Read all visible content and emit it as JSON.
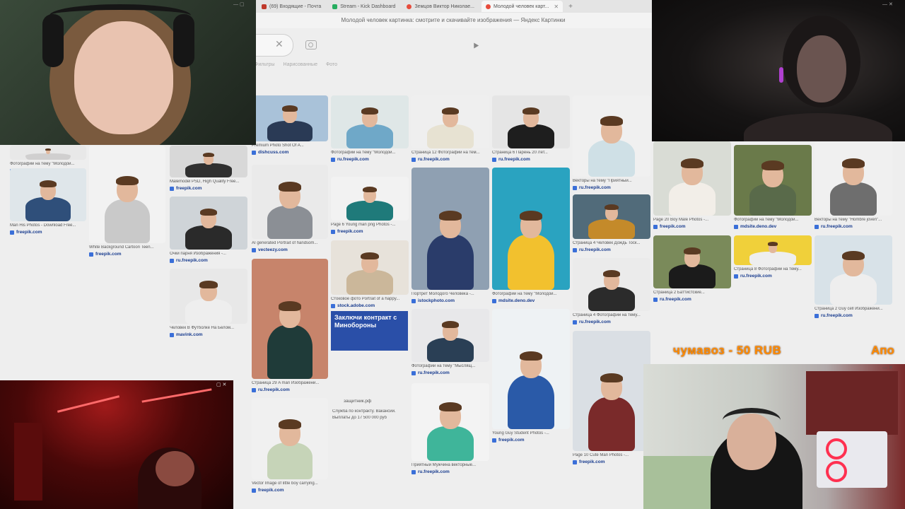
{
  "browser": {
    "tabs": [
      {
        "label": "(69) Входящие - Почта",
        "color": "#c0392b",
        "active": false
      },
      {
        "label": "Stream - Kick Dashboard",
        "color": "#27ae60",
        "active": false
      },
      {
        "label": "Земцов Виктор Николае...",
        "color": "#e74c3c",
        "active": false
      },
      {
        "label": "Молодой человек карт...",
        "color": "#e74c3c",
        "active": true
      }
    ],
    "title": "Молодой человек картинка: смотрите и скачивайте изображения — Яндекс Картинки",
    "new_tab": "+",
    "clear_search": "✕"
  },
  "filters": [
    "Фильтры",
    "Нарисованные",
    "Фото"
  ],
  "results": [
    {
      "cap": "Фотографии на тему \"Молодой...",
      "src": "ru.freepik.com"
    },
    {
      "cap": "Man His Photos - Download Free...",
      "src": "freepik.com"
    },
    {
      "cap": "White Background Cartoon Teen...",
      "src": "freepik.com"
    },
    {
      "cap": "Malemodel PSD, High Quality Free...",
      "src": "freepik.com"
    },
    {
      "cap": "Очки парня Изображения -...",
      "src": "ru.freepik.com"
    },
    {
      "cap": "Человек В Футболке На Белом...",
      "src": "mavink.com"
    },
    {
      "cap": "Premium Photo Shot Of A...",
      "src": "dishcuss.com"
    },
    {
      "cap": "AI generated Portrait of handsom...",
      "src": "vecteezy.com"
    },
    {
      "cap": "Страница 29 A man Изображени...",
      "src": "ru.freepik.com"
    },
    {
      "cap": "Vector Image of little boy carrying...",
      "src": "freepik.com"
    },
    {
      "cap": "Фотографии на тему \"Молодой...",
      "src": "ru.freepik.com"
    },
    {
      "cap": "Page 6 Young man png Photos -...",
      "src": "freepik.com"
    },
    {
      "cap": "Стоковое фото Portrait of a happy...",
      "src": "stock.adobe.com"
    },
    {
      "cap": "Страница 12 Фотографии на тем...",
      "src": "ru.freepik.com"
    },
    {
      "cap": "Портрет Молодого Человека -...",
      "src": "istockphoto.com"
    },
    {
      "cap": "Фотографии на тему \"Мыслящ...",
      "src": "ru.freepik.com"
    },
    {
      "cap": "Приятный Мужчина векторные...",
      "src": "ru.freepik.com"
    },
    {
      "cap": "Страница 6 Парень 20 Лет...",
      "src": "ru.freepik.com"
    },
    {
      "cap": "Фотографии на тему \"Молодой...",
      "src": "mdsite.deno.dev"
    },
    {
      "cap": "Young Guy Student Photos -...",
      "src": "freepik.com"
    },
    {
      "cap": "Векторы на тему \"Приятный...",
      "src": "ru.freepik.com"
    },
    {
      "cap": "Страница 4 Человек Дождь Тоск...",
      "src": "ru.freepik.com"
    },
    {
      "cap": "Страница 4 Фотографии на тему...",
      "src": "ru.freepik.com"
    },
    {
      "cap": "Page 10 Cute Man Photos -...",
      "src": "freepik.com"
    },
    {
      "cap": "Page 20 Boy Male Photos -...",
      "src": "freepik.com"
    },
    {
      "cap": "Страница 2 Баттистские...",
      "src": "ru.freepik.com"
    },
    {
      "cap": "Фотографии на тему \"Молодой...",
      "src": "mdsite.deno.dev"
    },
    {
      "cap": "Страница 8 Фотографии на тему...",
      "src": "ru.freepik.com"
    },
    {
      "cap": "Векторы на тему \"Hombre joven\"...",
      "src": "ru.freepik.com"
    },
    {
      "cap": "Страница 2 Guy cell Изображени...",
      "src": "ru.freepik.com"
    }
  ],
  "ad": {
    "headline": "Заключи контракт с Минобороны",
    "domain": "защитник.рф",
    "caption": "Служба по контракту. Вакансии.",
    "caption2": "Выплаты до 17 500 000 руб"
  },
  "donation": {
    "text": "чумавоз - 50 RUB",
    "trail": "Апо"
  },
  "colors": {
    "accent": "#ff8a00",
    "link": "#1a3d8f"
  }
}
